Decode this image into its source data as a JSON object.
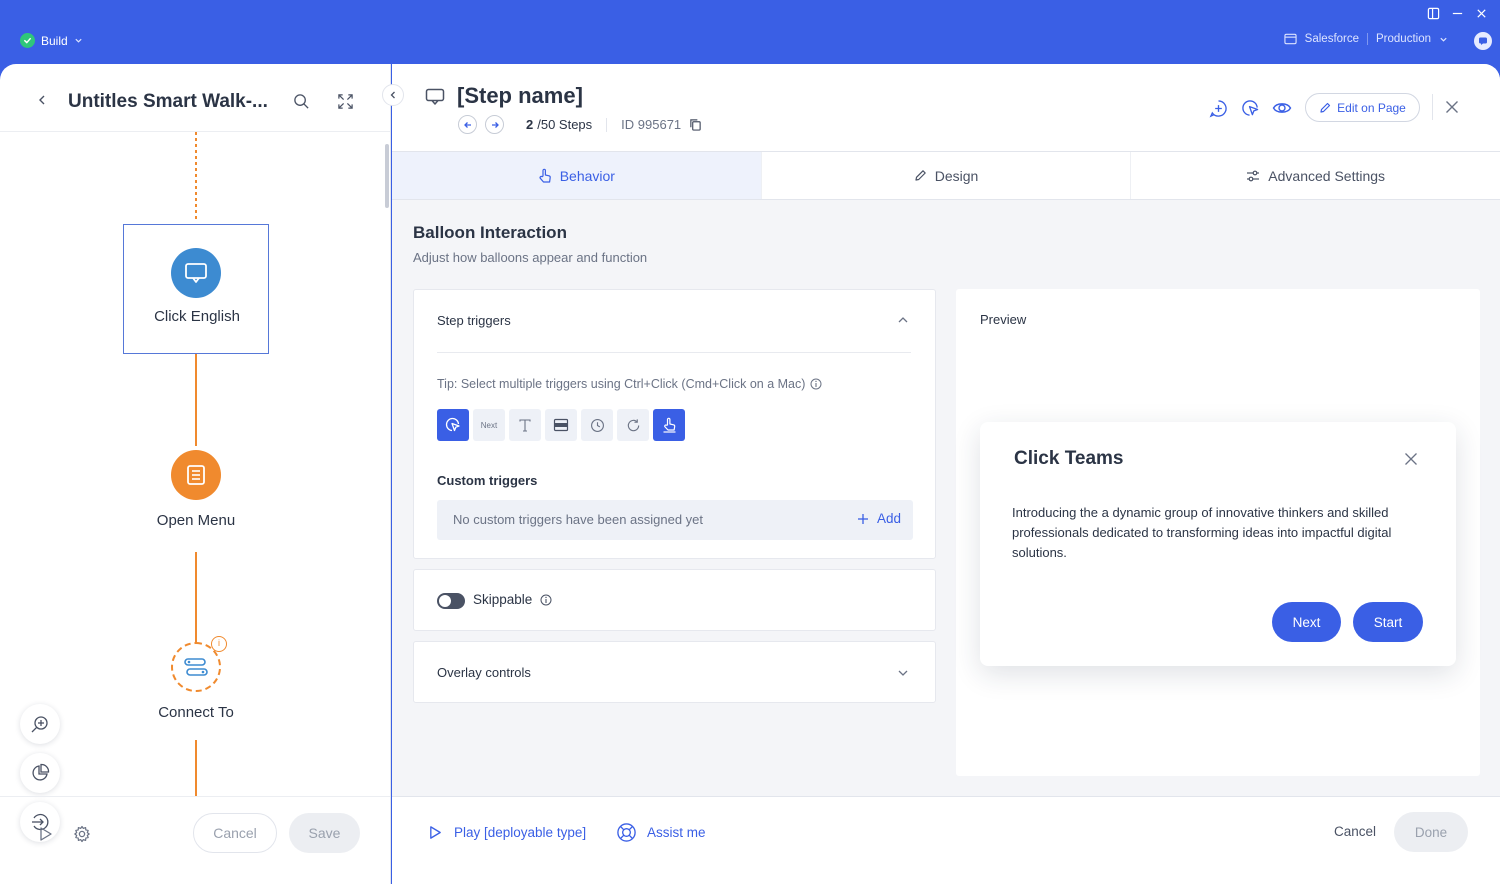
{
  "topbar": {
    "build_label": "Build",
    "platform_label": "Salesforce",
    "environment_label": "Production"
  },
  "left": {
    "title": "Untitles Smart Walk-...",
    "nodes": [
      {
        "label": "Click English",
        "icon": "balloon-icon",
        "color": "#3D8BD1"
      },
      {
        "label": "Open Menu",
        "icon": "menu-list-icon",
        "color": "#F08A2E"
      },
      {
        "label": "Connect To",
        "icon": "connect-icon",
        "badge": "i"
      }
    ],
    "footer": {
      "cancel_label": "Cancel",
      "save_label": "Save"
    }
  },
  "step": {
    "name": "[Step name]",
    "current": "2",
    "total_text": "/50 Steps",
    "id_text": "ID 995671",
    "edit_on_page_label": "Edit on Page"
  },
  "tabs": [
    {
      "label": "Behavior",
      "active": true
    },
    {
      "label": "Design",
      "active": false
    },
    {
      "label": "Advanced Settings",
      "active": false
    }
  ],
  "section": {
    "title": "Balloon Interaction",
    "subtitle": "Adjust how balloons appear and function"
  },
  "triggers": {
    "title": "Step triggers",
    "tip": "Tip: Select multiple triggers using Ctrl+Click (Cmd+Click on a Mac)",
    "next_icon_label": "Next",
    "custom_title": "Custom triggers",
    "custom_empty": "No custom triggers have been assigned yet",
    "add_label": "Add"
  },
  "skippable": {
    "label": "Skippable",
    "on": false
  },
  "overlay": {
    "label": "Overlay controls"
  },
  "preview": {
    "label": "Preview",
    "balloon_title": "Click Teams",
    "balloon_text": "Introducing the a dynamic group of innovative thinkers and skilled professionals dedicated to transforming ideas into impactful digital solutions.",
    "next_label": "Next",
    "start_label": "Start"
  },
  "footer": {
    "play_label": "Play [deployable type]",
    "assist_label": "Assist me",
    "cancel_label": "Cancel",
    "done_label": "Done"
  },
  "colors": {
    "accent": "#3A5FE5",
    "orange": "#F08A2E",
    "node_blue": "#3D8BD1",
    "success": "#2FC67A"
  }
}
